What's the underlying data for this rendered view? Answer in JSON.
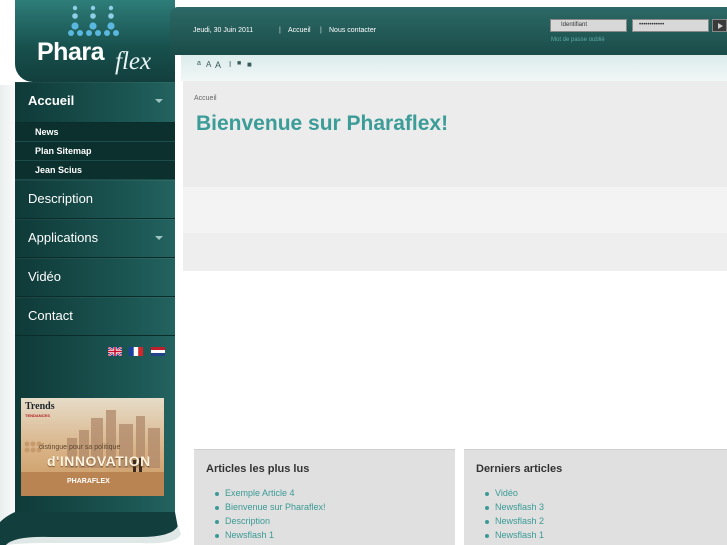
{
  "logo": {
    "part1": "Phara",
    "part2": "flex"
  },
  "header": {
    "date": "Jeudi, 30 Juin 2011",
    "sep1": "|",
    "link_home": "Accueil",
    "sep2": "|",
    "link_contact": "Nous contacter"
  },
  "login": {
    "username_placeholder": "Identifiant",
    "password_placeholder": "••••••••••••",
    "forgot_label": "Mot de passe oublié"
  },
  "toolbar": {
    "items": [
      "a",
      "A",
      "A",
      "I",
      "■",
      "■"
    ]
  },
  "nav": {
    "items": [
      {
        "label": "Accueil",
        "active": true,
        "has_submenu": true
      },
      {
        "label": "Description"
      },
      {
        "label": "Applications",
        "has_submenu": true
      },
      {
        "label": "Vidéo"
      },
      {
        "label": "Contact"
      }
    ],
    "sub_items": [
      "News",
      "Plan Sitemap",
      "Jean Scius"
    ]
  },
  "languages": [
    "en",
    "fr",
    "nl"
  ],
  "promo": {
    "magazine": "Trends",
    "magazine_sub": "TENDANCES",
    "line1": "distingue pour sa politique",
    "line2": "d'INNOVATION",
    "brand": "PHARAFLEX"
  },
  "breadcrumb": "Accueil",
  "page_title": "Bienvenue sur Pharaflex!",
  "boxes": {
    "popular": {
      "title": "Articles les plus lus",
      "items": [
        "Exemple Article 4",
        "Bienvenue sur Pharaflex!",
        "Description",
        "Newsflash 1"
      ]
    },
    "latest": {
      "title": "Derniers articles",
      "items": [
        "Vidéo",
        "Newsflash 3",
        "Newsflash 2",
        "Newsflash 1"
      ]
    }
  },
  "colors": {
    "brand_teal": "#3b9c98",
    "nav_dark": "#0f3a38",
    "header_teal": "#2c6966"
  }
}
